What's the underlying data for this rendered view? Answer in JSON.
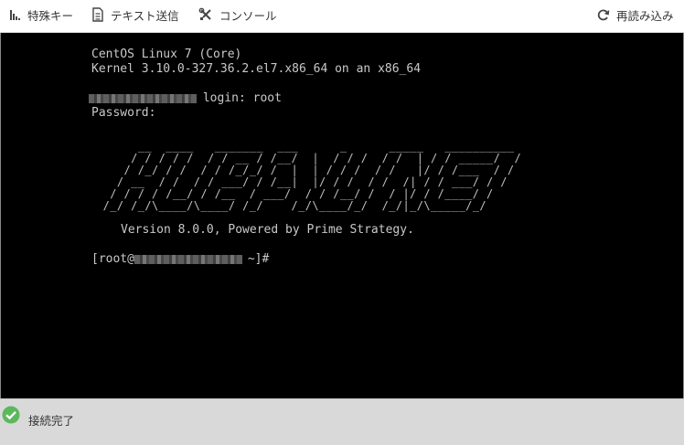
{
  "toolbar": {
    "special_keys_label": "特殊キー",
    "send_text_label": "テキスト送信",
    "console_label": "コンソール",
    "reload_label": "再読み込み"
  },
  "terminal": {
    "os_line": "CentOS Linux 7 (Core)",
    "kernel_line": "Kernel 3.10.0-327.36.2.el7.x86_64 on an x86_64",
    "login_line": " login: root",
    "password_line": "Password:",
    "ascii_logo": "      __  ____   _______  ___      _      _____   __________\n     / / / / /  / / __ / /__/  |  / / /  / /  | / / _____/  /\n    / /_/ / /  / / /_/_/ /  |  | / / /  / /   |/ / /___  / /\n   / __  / /  / / ___/ / /__|  |/ / /  / /  /| / / ___/ / /\n  / / / / /__/ / /__  / ___/  / / /__/ /  / |/ / /____/ /\n /_/ /_/\\____/\\____/ /_/    /_/\\____/_/  /_/|_/\\_____/_/",
    "version_line": "Version 8.0.0, Powered by Prime Strategy.",
    "prompt_prefix": "[root@",
    "prompt_suffix": " ~]#"
  },
  "status": {
    "text": "接続完了",
    "color": "#5cb85c"
  }
}
